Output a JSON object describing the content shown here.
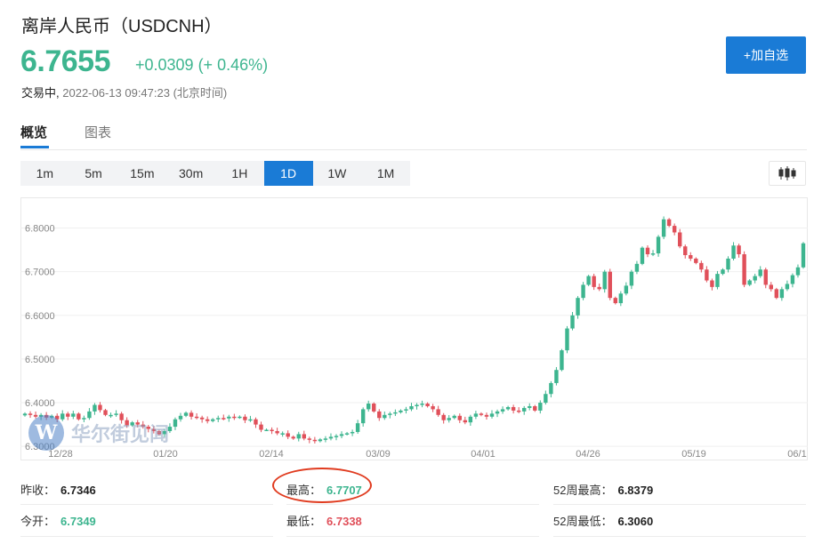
{
  "header": {
    "title": "离岸人民币（USDCNH）",
    "price": "6.7655",
    "change": "+0.0309 (+ 0.46%)",
    "status": "交易中,",
    "timestamp": "2022-06-13 09:47:23 (北京时间)",
    "add_label": "+加自选"
  },
  "tabs": [
    {
      "label": "概览",
      "active": true
    },
    {
      "label": "图表",
      "active": false
    }
  ],
  "periods": [
    {
      "label": "1m",
      "active": false
    },
    {
      "label": "5m",
      "active": false
    },
    {
      "label": "15m",
      "active": false
    },
    {
      "label": "30m",
      "active": false
    },
    {
      "label": "1H",
      "active": false
    },
    {
      "label": "1D",
      "active": true
    },
    {
      "label": "1W",
      "active": false
    },
    {
      "label": "1M",
      "active": false
    }
  ],
  "watermark": {
    "logo": "W",
    "text": "华尔街见闻"
  },
  "stats": {
    "prev_close": {
      "label": "昨收：",
      "value": "6.7346"
    },
    "open": {
      "label": "今开：",
      "value": "6.7349"
    },
    "high": {
      "label": "最高：",
      "value": "6.7707"
    },
    "low": {
      "label": "最低：",
      "value": "6.7338"
    },
    "high52": {
      "label": "52周最高：",
      "value": "6.8379"
    },
    "low52": {
      "label": "52周最低：",
      "value": "6.3060"
    }
  },
  "colors": {
    "up": "#3db58f",
    "down": "#e0505a",
    "accent": "#1a7bd6",
    "highlight": "#e03b1f"
  },
  "icons": {
    "chart_type": "candlestick-icon"
  },
  "chart_data": {
    "type": "candlestick",
    "yticks": [
      "6.8000",
      "6.7000",
      "6.6000",
      "6.5000",
      "6.4000",
      "6.3000"
    ],
    "ylim": [
      6.28,
      6.85
    ],
    "xticks": [
      "12/28",
      "01/20",
      "02/14",
      "03/09",
      "04/01",
      "04/26",
      "05/19",
      "06/1"
    ],
    "grid": true,
    "close": [
      6.375,
      6.372,
      6.368,
      6.372,
      6.366,
      6.37,
      6.362,
      6.375,
      6.368,
      6.375,
      6.362,
      6.365,
      6.38,
      6.395,
      6.383,
      6.372,
      6.372,
      6.375,
      6.36,
      6.348,
      6.355,
      6.35,
      6.345,
      6.34,
      6.335,
      6.328,
      6.335,
      6.345,
      6.362,
      6.37,
      6.377,
      6.368,
      6.366,
      6.362,
      6.358,
      6.362,
      6.365,
      6.364,
      6.368,
      6.366,
      6.368,
      6.36,
      6.362,
      6.35,
      6.338,
      6.338,
      6.335,
      6.33,
      6.33,
      6.322,
      6.318,
      6.328,
      6.318,
      6.315,
      6.312,
      6.316,
      6.318,
      6.322,
      6.324,
      6.328,
      6.33,
      6.333,
      6.353,
      6.385,
      6.398,
      6.38,
      6.365,
      6.372,
      6.375,
      6.378,
      6.382,
      6.385,
      6.392,
      6.395,
      6.398,
      6.392,
      6.385,
      6.372,
      6.36,
      6.365,
      6.37,
      6.36,
      6.355,
      6.368,
      6.375,
      6.372,
      6.368,
      6.375,
      6.38,
      6.385,
      6.39,
      6.382,
      6.38,
      6.388,
      6.392,
      6.382,
      6.4,
      6.42,
      6.445,
      6.475,
      6.52,
      6.57,
      6.6,
      6.64,
      6.67,
      6.69,
      6.665,
      6.66,
      6.7,
      6.64,
      6.628,
      6.65,
      6.668,
      6.7,
      6.718,
      6.755,
      6.74,
      6.742,
      6.78,
      6.82,
      6.805,
      6.79,
      6.758,
      6.738,
      6.73,
      6.72,
      6.705,
      6.68,
      6.665,
      6.695,
      6.705,
      6.73,
      6.76,
      6.74,
      6.67,
      6.68,
      6.69,
      6.705,
      6.67,
      6.66,
      6.64,
      6.66,
      6.672,
      6.692,
      6.71,
      6.765
    ]
  }
}
